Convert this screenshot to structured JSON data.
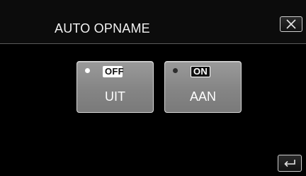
{
  "header": {
    "title": "AUTO OPNAME",
    "close_icon": "close-icon"
  },
  "options": [
    {
      "badge": "OFF",
      "label": "UIT",
      "selected": true
    },
    {
      "badge": "ON",
      "label": "AAN",
      "selected": false
    }
  ],
  "footer": {
    "back_icon": "back-return-icon"
  },
  "colors": {
    "background": "#000000",
    "button_face": "#8a8a8a",
    "button_border": "#d8d8d8",
    "text": "#ffffff"
  }
}
